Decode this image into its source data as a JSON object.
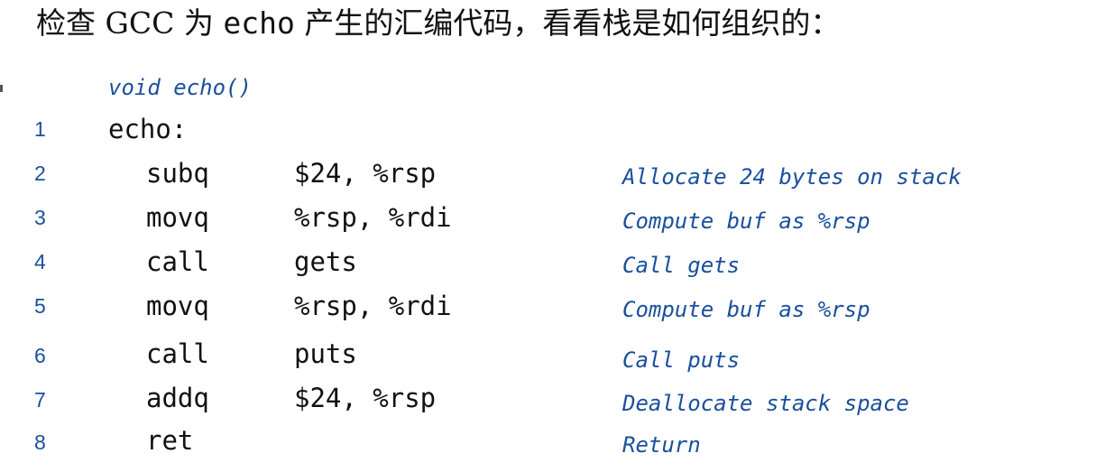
{
  "heading": {
    "prefix": "检查 GCC 为 ",
    "code_word": "echo",
    "suffix": " 产生的汇编代码，看看栈是如何组织的："
  },
  "listing": {
    "prototype": "void echo()",
    "label_line_number": "1",
    "label": "echo:",
    "instructions": [
      {
        "line": "2",
        "op": "subq",
        "args": "$24, %rsp",
        "comment": "Allocate 24 bytes on stack"
      },
      {
        "line": "3",
        "op": "movq",
        "args": "%rsp, %rdi",
        "comment": "Compute buf as %rsp"
      },
      {
        "line": "4",
        "op": "call",
        "args": "gets",
        "comment": "Call gets"
      },
      {
        "line": "5",
        "op": "movq",
        "args": "%rsp, %rdi",
        "comment": "Compute buf as %rsp"
      },
      {
        "line": "6",
        "op": "call",
        "args": "puts",
        "comment": "Call puts"
      },
      {
        "line": "7",
        "op": "addq",
        "args": "$24, %rsp",
        "comment": "Deallocate stack space"
      },
      {
        "line": "8",
        "op": "ret",
        "args": "",
        "comment": "Return"
      }
    ]
  },
  "colors": {
    "text": "#111111",
    "annotation_blue": "#1a4f9c",
    "background": "#ffffff"
  }
}
